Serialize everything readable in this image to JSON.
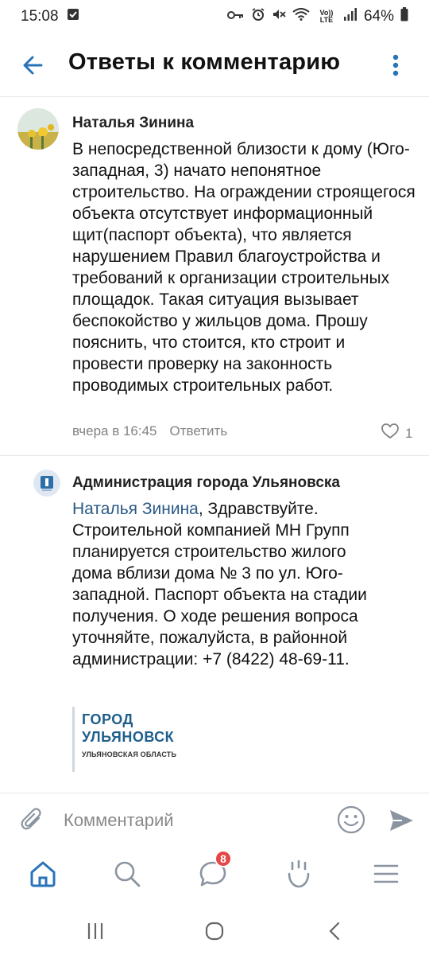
{
  "status_bar": {
    "time": "15:08",
    "battery": "64%",
    "lte_label": "Vo)) LTE",
    "icons": [
      "gallery-check-icon",
      "key-icon",
      "alarm-icon",
      "mute-icon",
      "wifi-icon",
      "volte-icon",
      "signal-icon",
      "battery-icon"
    ]
  },
  "header": {
    "title": "Ответы к комментарию",
    "back_icon": "back-arrow-icon",
    "more_icon": "more-vertical-icon",
    "accent_color": "#2a5885"
  },
  "comments": [
    {
      "author": "Наталья Зинина",
      "text": "В непосредственной близости к дому (Юго-западная, 3) начато непонятное строительство. На ограждении строящегося объекта отсутствует информационный щит(паспорт объекта), что является нарушением Правил благоустройства и требований к организации строительных площадок. Такая ситуация вызывает беспокойство у жильцов дома. Прошу пояснить, что стоится, кто строит и провести проверку на законность проводимых строительных работ.",
      "time": "вчера в 16:45",
      "reply_label": "Ответить",
      "likes": "1"
    },
    {
      "author": "Администрация города Ульяновска",
      "mention": "Наталья Зинина",
      "text": ", Здравствуйте. Строительной компанией МН Групп планируется строительство жилого дома вблизи дома № 3 по ул. Юго-западной. Паспорт объекта на стадии получения. О ходе решения вопроса уточняйте, пожалуйста, в районной администрации: +7 (8422) 48-69-11.",
      "attachment": {
        "line1": "ГОРОД",
        "line2": "УЛЬЯНОВСК",
        "subtitle": "УЛЬЯНОВСКАЯ ОБЛАСТЬ"
      }
    }
  ],
  "composer": {
    "placeholder": "Комментарий"
  },
  "bottom_nav": {
    "items": [
      "home-icon",
      "search-icon",
      "messages-icon",
      "notifications-icon",
      "menu-icon"
    ],
    "messages_badge": "8",
    "badge_color": "#e64646"
  },
  "system_nav": {
    "items": [
      "recents-icon",
      "home-circle-icon",
      "back-chevron-icon"
    ]
  }
}
